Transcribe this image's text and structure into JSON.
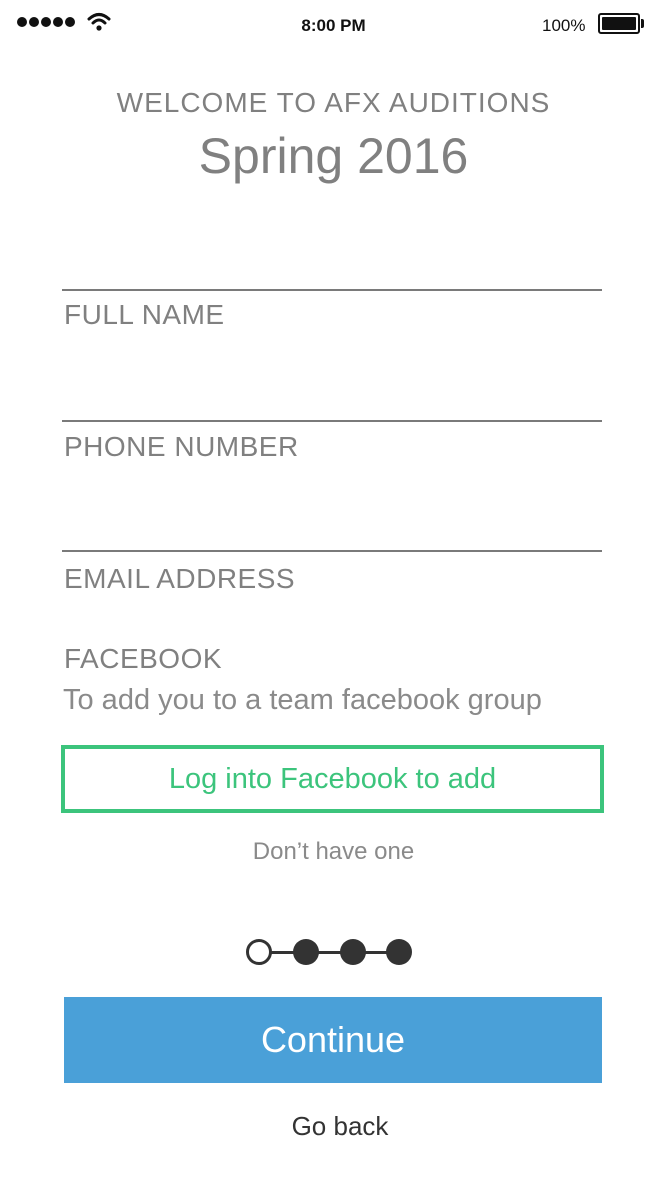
{
  "status_bar": {
    "time": "8:00 PM",
    "battery": "100%",
    "signal_icon": "signal-dots-icon",
    "wifi_icon": "wifi-icon",
    "battery_icon": "battery-icon"
  },
  "header": {
    "welcome": "WELCOME TO AFX AUDITIONS",
    "season": "Spring 2016"
  },
  "form": {
    "full_name": {
      "label": "FULL NAME",
      "value": ""
    },
    "phone": {
      "label": "PHONE NUMBER",
      "value": ""
    },
    "email": {
      "label": "EMAIL ADDRESS",
      "value": ""
    },
    "facebook": {
      "label": "FACEBOOK",
      "description": "To add you to a team facebook group",
      "button": "Log into Facebook to add",
      "no_account": "Don’t have one"
    }
  },
  "progress": {
    "current_step": 1,
    "total_steps": 4
  },
  "actions": {
    "continue": "Continue",
    "go_back": "Go back"
  },
  "colors": {
    "text": "#808080",
    "facebook_accent": "#3cc47c",
    "continue_button": "#4aa0d8",
    "step_dark": "#333333"
  }
}
